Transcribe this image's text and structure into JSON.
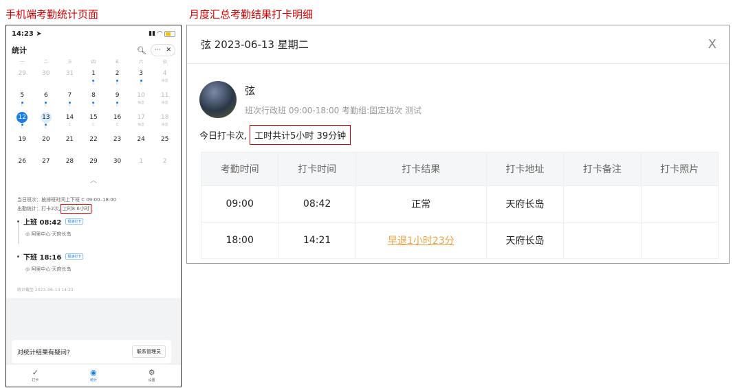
{
  "captions": {
    "mobile": "手机端考勤统计页面",
    "dialog": "月度汇总考勤结果打卡明细"
  },
  "phone": {
    "status_time": "14:23",
    "status_location_icon": "location-arrow-icon",
    "status_signal": "… •",
    "nav_title": "统计",
    "nav_more": "···",
    "nav_close": "✕",
    "weekdays": [
      "一",
      "二",
      "三",
      "四",
      "五",
      "六",
      "日"
    ],
    "calendar": [
      [
        {
          "n": "29",
          "m": true,
          "s": ""
        },
        {
          "n": "30",
          "m": true,
          "s": ""
        },
        {
          "n": "31",
          "m": true,
          "s": ""
        },
        {
          "n": "1",
          "dot": true,
          "s": "C"
        },
        {
          "n": "2",
          "dot": true,
          "s": "C"
        },
        {
          "n": "3",
          "dot": true,
          "s": "C"
        },
        {
          "n": "4",
          "m": true,
          "s": "休息"
        }
      ],
      [
        {
          "n": "5",
          "dot": true,
          "s": "C"
        },
        {
          "n": "6",
          "dot": true,
          "s": "C"
        },
        {
          "n": "7",
          "dot": true,
          "s": "C"
        },
        {
          "n": "8",
          "dot": true,
          "s": "C"
        },
        {
          "n": "9",
          "dot": true,
          "s": "C"
        },
        {
          "n": "10",
          "m": true,
          "s": "休息"
        },
        {
          "n": "11",
          "m": true,
          "s": "休息"
        }
      ],
      [
        {
          "n": "12",
          "today": true,
          "dot": true,
          "s": "C"
        },
        {
          "n": "13",
          "sel": true,
          "dot": true,
          "s": "C"
        },
        {
          "n": "14",
          "s": "C"
        },
        {
          "n": "15",
          "s": "C"
        },
        {
          "n": "16",
          "s": "C"
        },
        {
          "n": "17",
          "m": true,
          "s": "休息"
        },
        {
          "n": "18",
          "m": true,
          "s": "休息"
        }
      ],
      [
        {
          "n": "19",
          "s": ""
        },
        {
          "n": "20",
          "s": ""
        },
        {
          "n": "21",
          "s": ""
        },
        {
          "n": "22",
          "s": ""
        },
        {
          "n": "23",
          "s": ""
        },
        {
          "n": "24",
          "s": ""
        },
        {
          "n": "25",
          "s": ""
        }
      ],
      [
        {
          "n": "26",
          "s": ""
        },
        {
          "n": "27",
          "s": ""
        },
        {
          "n": "28",
          "s": ""
        },
        {
          "n": "29",
          "s": ""
        },
        {
          "n": "30",
          "s": ""
        },
        {
          "n": "1",
          "m": true,
          "s": ""
        },
        {
          "n": "2",
          "m": true,
          "s": ""
        }
      ]
    ],
    "collapse": "︿",
    "shift_line": "当日班次：按排班时间上下班 C 09:00–18:00",
    "stat_prefix": "出勤统计：打卡2次,",
    "stat_hours": "工时8.6小时",
    "punches": [
      {
        "label": "上班 08:42",
        "tag": "极速打卡",
        "location": "◎ 阿里中心·天府长岛"
      },
      {
        "label": "下班 18:16",
        "tag": "极速打卡",
        "location": "◎ 阿里中心·天府长岛"
      }
    ],
    "stat_time": "统计截至 2023–06–13 14:23",
    "question": "对统计结果有疑问?",
    "contact_button": "联系管理员",
    "tabs": [
      {
        "icon": "✓",
        "label": "打卡",
        "icon_name": "check-in-icon"
      },
      {
        "icon": "◉",
        "label": "统计",
        "icon_name": "statistics-icon",
        "active": true
      },
      {
        "icon": "⚙",
        "label": "设置",
        "icon_name": "settings-icon"
      }
    ]
  },
  "dialog": {
    "title": "弦 2023-06-13 星期二",
    "close": "X",
    "user_name": "弦",
    "shift_info": "班次行政班 09:00-18:00 考勤组:固定班次 测试",
    "today_prefix": "今日打卡次,",
    "worktime": "工时共计5小时 39分钟",
    "columns": [
      "考勤时间",
      "打卡时间",
      "打卡结果",
      "打卡地址",
      "打卡备注",
      "打卡照片"
    ],
    "rows": [
      {
        "schedule": "09:00",
        "punch": "08:42",
        "result": "正常",
        "address": "天府长岛",
        "note": "",
        "photo": "",
        "late": false
      },
      {
        "schedule": "18:00",
        "punch": "14:21",
        "result": "早退1小时23分",
        "address": "天府长岛",
        "note": "",
        "photo": "",
        "late": true
      }
    ]
  }
}
